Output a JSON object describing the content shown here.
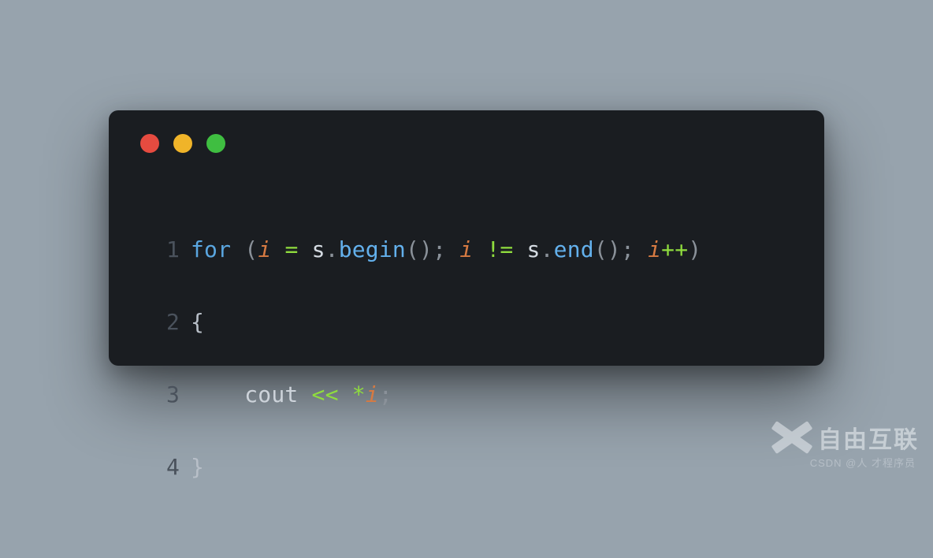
{
  "code": {
    "line_numbers": [
      "1",
      "2",
      "3",
      "4"
    ],
    "l1": {
      "for": "for",
      "sp1": " ",
      "lpar": "(",
      "i1": "i",
      "sp2": " ",
      "eq": "=",
      "sp3": " ",
      "s1": "s",
      "dot1": ".",
      "begin": "begin",
      "lpar2": "(",
      "rpar2": ")",
      "semi1": ";",
      "sp4": " ",
      "i2": "i",
      "sp5": " ",
      "neq": "!=",
      "sp6": " ",
      "s2": "s",
      "dot2": ".",
      "end": "end",
      "lpar3": "(",
      "rpar3": ")",
      "semi2": ";",
      "sp7": " ",
      "i3": "i",
      "inc": "++",
      "rpar": ")"
    },
    "l2": {
      "brace": "{"
    },
    "l3": {
      "indent": "    ",
      "cout": "cout",
      "sp1": " ",
      "lshift": "<<",
      "sp2": " ",
      "star": "*",
      "i": "i",
      "semi": ";"
    },
    "l4": {
      "brace": "}"
    }
  },
  "watermark": {
    "brand": "自由互联",
    "sub": "CSDN @人 才程序员"
  }
}
